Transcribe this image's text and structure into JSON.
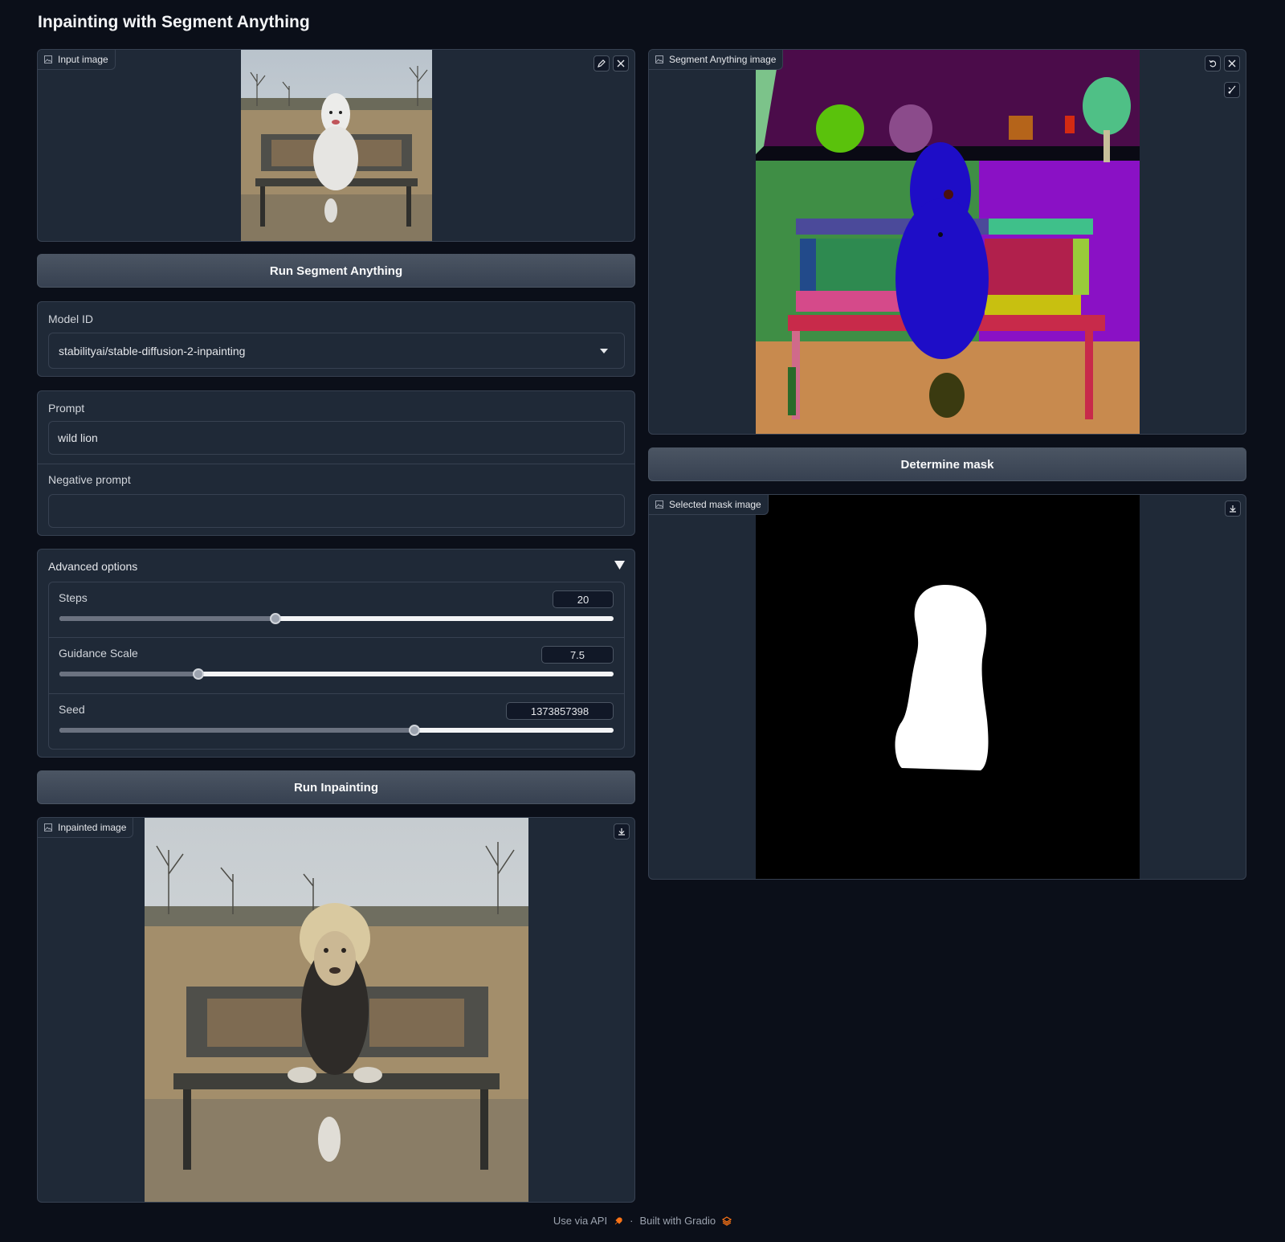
{
  "page_title": "Inpainting with Segment Anything",
  "input_image": {
    "label": "Input image"
  },
  "segment_image": {
    "label": "Segment Anything image"
  },
  "mask_image": {
    "label": "Selected mask image"
  },
  "inpainted_image": {
    "label": "Inpainted image"
  },
  "buttons": {
    "run_segment": "Run Segment Anything",
    "determine_mask": "Determine mask",
    "run_inpainting": "Run Inpainting"
  },
  "model": {
    "label": "Model ID",
    "value": "stabilityai/stable-diffusion-2-inpainting"
  },
  "prompt": {
    "label": "Prompt",
    "value": "wild lion"
  },
  "negative_prompt": {
    "label": "Negative prompt",
    "value": ""
  },
  "advanced": {
    "title": "Advanced options",
    "steps": {
      "label": "Steps",
      "value": "20",
      "fraction": 0.39
    },
    "guidance": {
      "label": "Guidance Scale",
      "value": "7.5",
      "fraction": 0.25
    },
    "seed": {
      "label": "Seed",
      "value": "1373857398",
      "fraction": 0.64
    }
  },
  "footer": {
    "api": "Use via API",
    "separator": "·",
    "built": "Built with Gradio"
  },
  "icons": [
    "image-icon",
    "edit-icon",
    "close-icon",
    "undo-icon",
    "brush-icon",
    "download-icon",
    "dropdown-caret-icon",
    "collapse-triangle-icon",
    "rocket-icon",
    "gradio-logo-icon"
  ]
}
